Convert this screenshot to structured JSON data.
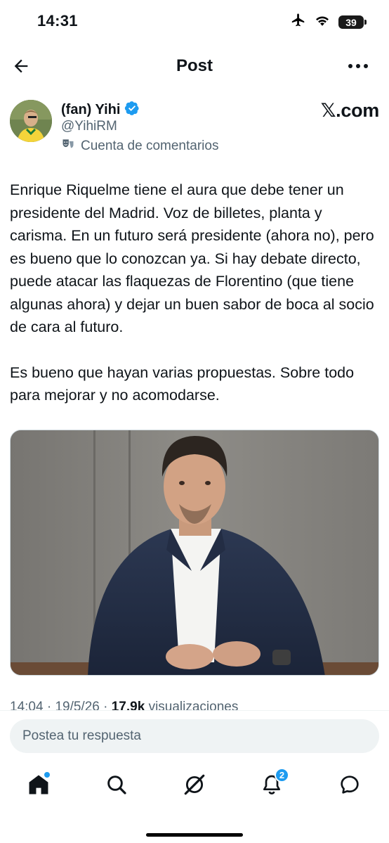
{
  "status_bar": {
    "time": "14:31",
    "battery_level": "39",
    "icons": [
      "airplane-icon",
      "wifi-icon",
      "battery-icon"
    ]
  },
  "header": {
    "title": "Post",
    "back_icon": "arrow-left-icon",
    "more_icon": "more-horizontal-icon"
  },
  "post": {
    "author": {
      "name": "(fan) Yihi",
      "handle": "@YihiRM",
      "verified": true,
      "verified_color": "#1d9bf0",
      "account_label": "Cuenta de comentarios"
    },
    "source_label": "𝕏.com",
    "text": [
      "Enrique Riquelme tiene el aura que debe tener un presidente del Madrid. Voz de billetes, planta y carisma. En un futuro será presidente (ahora no), pero es bueno que lo conozcan ya. Si hay debate directo, puede atacar las flaquezas de Florentino (que tiene algunas ahora) y dejar un buen sabor de boca al socio de cara al futuro.",
      "Es bueno que hayan varias propuestas. Sobre todo para mejorar y no acomodarse."
    ],
    "meta": {
      "time": "14:04",
      "date": "19/5/26",
      "views_count": "17,9k",
      "views_label": "visualizaciones"
    }
  },
  "reply": {
    "placeholder": "Postea tu respuesta"
  },
  "tab_bar": {
    "items": [
      {
        "icon": "home-icon",
        "active": true
      },
      {
        "icon": "search-icon",
        "active": false
      },
      {
        "icon": "grok-icon",
        "active": false
      },
      {
        "icon": "bell-icon",
        "active": false,
        "badge": "2"
      },
      {
        "icon": "messages-icon",
        "active": false
      }
    ],
    "accent_color": "#1d9bf0"
  }
}
